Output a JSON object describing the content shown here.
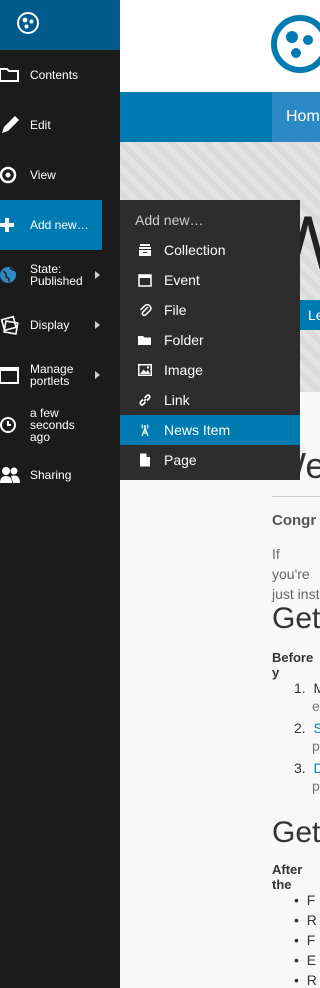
{
  "toolbar": {
    "items": [
      {
        "label": "Contents",
        "icon": "folder-icon"
      },
      {
        "label": "Edit",
        "icon": "pencil-icon"
      },
      {
        "label": "View",
        "icon": "eye-icon"
      },
      {
        "label": "Add new…",
        "icon": "plus-icon"
      },
      {
        "label_line1": "State:",
        "label_line2": "Published",
        "icon": "globe-icon"
      },
      {
        "label": "Display",
        "icon": "display-icon"
      },
      {
        "label_line1": "Manage",
        "label_line2": "portlets",
        "icon": "portlets-icon"
      },
      {
        "label_line1": "a few",
        "label_line2": "seconds",
        "label_line3": "ago",
        "icon": "clock-icon"
      },
      {
        "label": "Sharing",
        "icon": "users-icon"
      }
    ]
  },
  "submenu": {
    "header": "Add new…",
    "items": [
      {
        "label": "Collection",
        "icon": "collection-icon"
      },
      {
        "label": "Event",
        "icon": "calendar-icon"
      },
      {
        "label": "File",
        "icon": "paperclip-icon"
      },
      {
        "label": "Folder",
        "icon": "folder-icon"
      },
      {
        "label": "Image",
        "icon": "image-icon"
      },
      {
        "label": "Link",
        "icon": "link-icon"
      },
      {
        "label": "News Item",
        "icon": "antenna-icon"
      },
      {
        "label": "Page",
        "icon": "page-icon"
      }
    ]
  },
  "site": {
    "nav_home": "Hom",
    "hero_title": "W",
    "hero_button": "Le",
    "breadcrumb": "e",
    "page_title": "We",
    "lead": "Congr",
    "p1_line1": "If you're",
    "p1_line2": "just inst",
    "h2_1": "Get",
    "before": "Before y",
    "ol": [
      {
        "num": "1.",
        "text": "M",
        "sub": "e"
      },
      {
        "num": "2.",
        "text": "S",
        "sub": "p"
      },
      {
        "num": "3.",
        "text": "D",
        "sub": "p"
      }
    ],
    "h2_2": "Get",
    "after": "After the",
    "ul": [
      "F",
      "R",
      "F",
      "E",
      "R"
    ]
  },
  "colors": {
    "toolbar_bg": "#1b1b1b",
    "toolbar_logo_bg": "#005a8c",
    "accent": "#007bb1",
    "submenu_bg": "#2d2d2d"
  }
}
